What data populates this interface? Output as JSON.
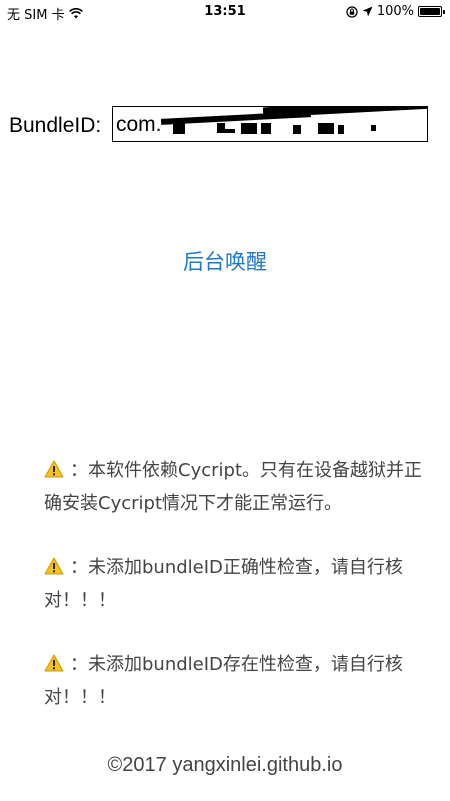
{
  "status_bar": {
    "carrier": "无 SIM 卡",
    "time": "13:51",
    "battery": "100%",
    "battery_level": 1.0
  },
  "form": {
    "bundle_label": "BundleID:",
    "bundle_value": "com."
  },
  "actions": {
    "wake_label": "后台唤醒"
  },
  "notes": [
    "：本软件依赖Cycript。只有在设备越狱并正确安装Cycript情况下才能正常运行。",
    "：未添加bundleID正确性检查，请自行核对！！！",
    "：未添加bundleID存在性检查，请自行核对！！！"
  ],
  "icons": {
    "warning": "warning-icon",
    "wifi": "wifi-icon",
    "rotation_lock": "rotation-lock-icon",
    "location": "location-arrow-icon",
    "battery": "battery-icon"
  },
  "colors": {
    "link_blue": "#1f78c8",
    "note_text": "#444444",
    "warning_yellow": "#f7c21b"
  },
  "footer": {
    "copyright": "©2017 yangxinlei.github.io"
  }
}
